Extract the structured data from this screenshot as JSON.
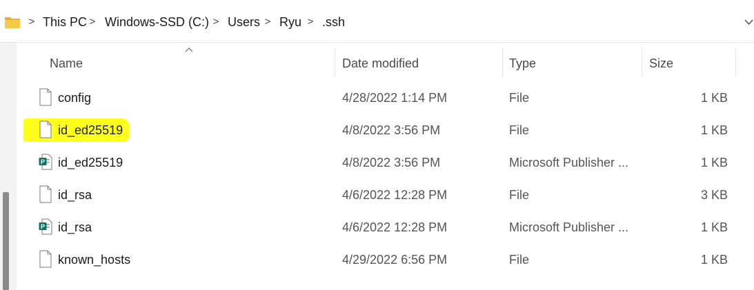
{
  "address": {
    "crumbs": [
      "This PC",
      "Windows-SSD (C:)",
      "Users",
      "Ryu",
      ".ssh"
    ],
    "separator": ">"
  },
  "columns": {
    "name": "Name",
    "date": "Date modified",
    "type": "Type",
    "size": "Size"
  },
  "files": [
    {
      "name": "config",
      "date": "4/28/2022 1:14 PM",
      "type": "File",
      "size": "1 KB",
      "icon": "generic-file-icon"
    },
    {
      "name": "id_ed25519",
      "date": "4/8/2022 3:56 PM",
      "type": "File",
      "size": "1 KB",
      "icon": "generic-file-icon",
      "highlighted": true
    },
    {
      "name": "id_ed25519",
      "date": "4/8/2022 3:56 PM",
      "type": "Microsoft Publisher ...",
      "size": "1 KB",
      "icon": "publisher-file-icon"
    },
    {
      "name": "id_rsa",
      "date": "4/6/2022 12:28 PM",
      "type": "File",
      "size": "3 KB",
      "icon": "generic-file-icon"
    },
    {
      "name": "id_rsa",
      "date": "4/6/2022 12:28 PM",
      "type": "Microsoft Publisher ...",
      "size": "1 KB",
      "icon": "publisher-file-icon"
    },
    {
      "name": "known_hosts",
      "date": "4/29/2022 6:56 PM",
      "type": "File",
      "size": "1 KB",
      "icon": "generic-file-icon"
    }
  ],
  "colors": {
    "highlight": "#ffff1e",
    "folder": "#f7c948",
    "publisher": "#077568"
  }
}
